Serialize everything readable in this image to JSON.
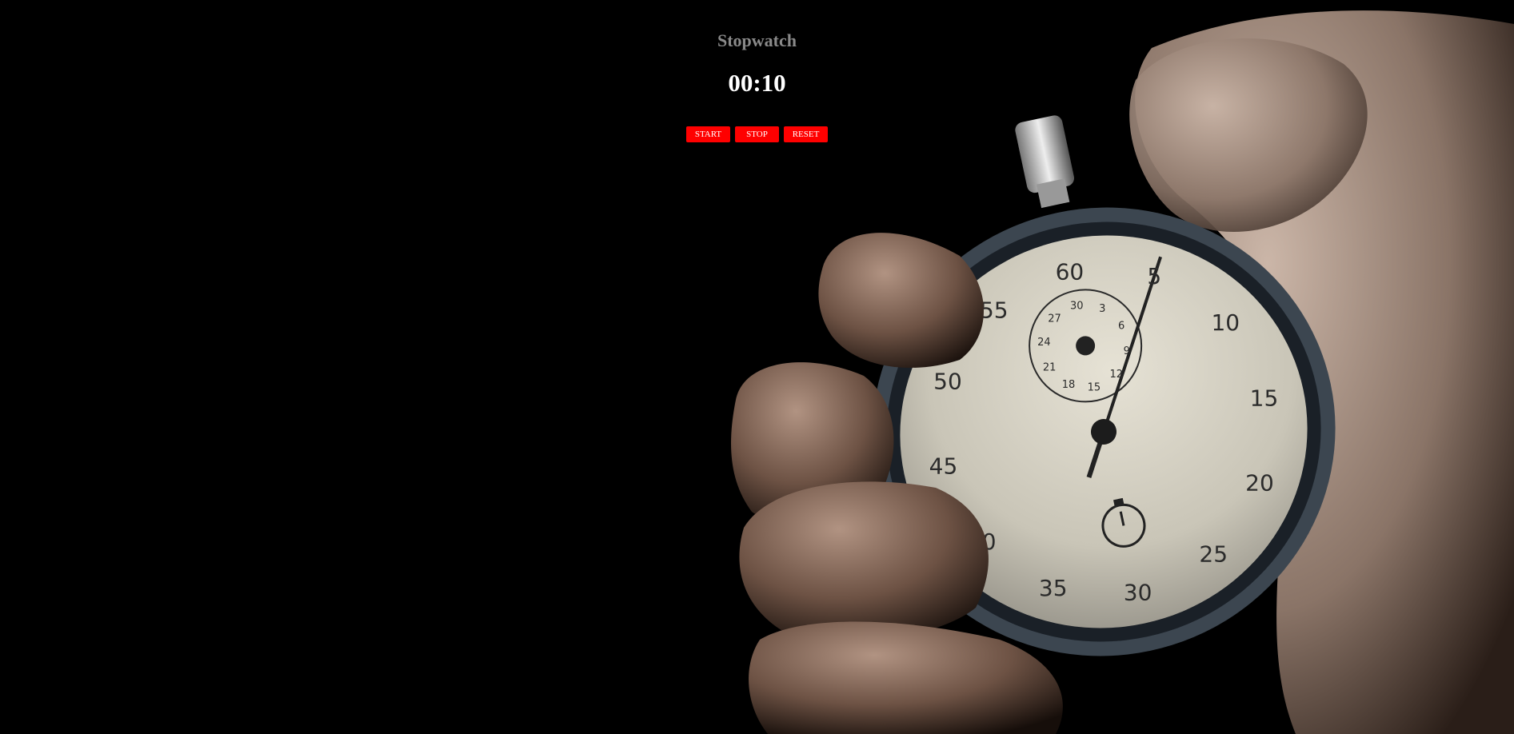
{
  "stopwatch": {
    "title": "Stopwatch",
    "time": "00:10",
    "buttons": {
      "start_label": "START",
      "stop_label": "STOP",
      "reset_label": "RESET"
    }
  },
  "colors": {
    "background": "#000000",
    "title": "#8a8a8a",
    "time": "#ffffff",
    "button_bg": "#ff0000",
    "button_text": "#ffffff"
  },
  "background_photo": {
    "dial_numbers": [
      "60",
      "5",
      "10",
      "15",
      "20",
      "25",
      "30",
      "35",
      "40",
      "45",
      "50",
      "55"
    ],
    "subdial_numbers": [
      "30",
      "3",
      "6",
      "9",
      "12",
      "15",
      "18",
      "21",
      "24",
      "27"
    ]
  }
}
